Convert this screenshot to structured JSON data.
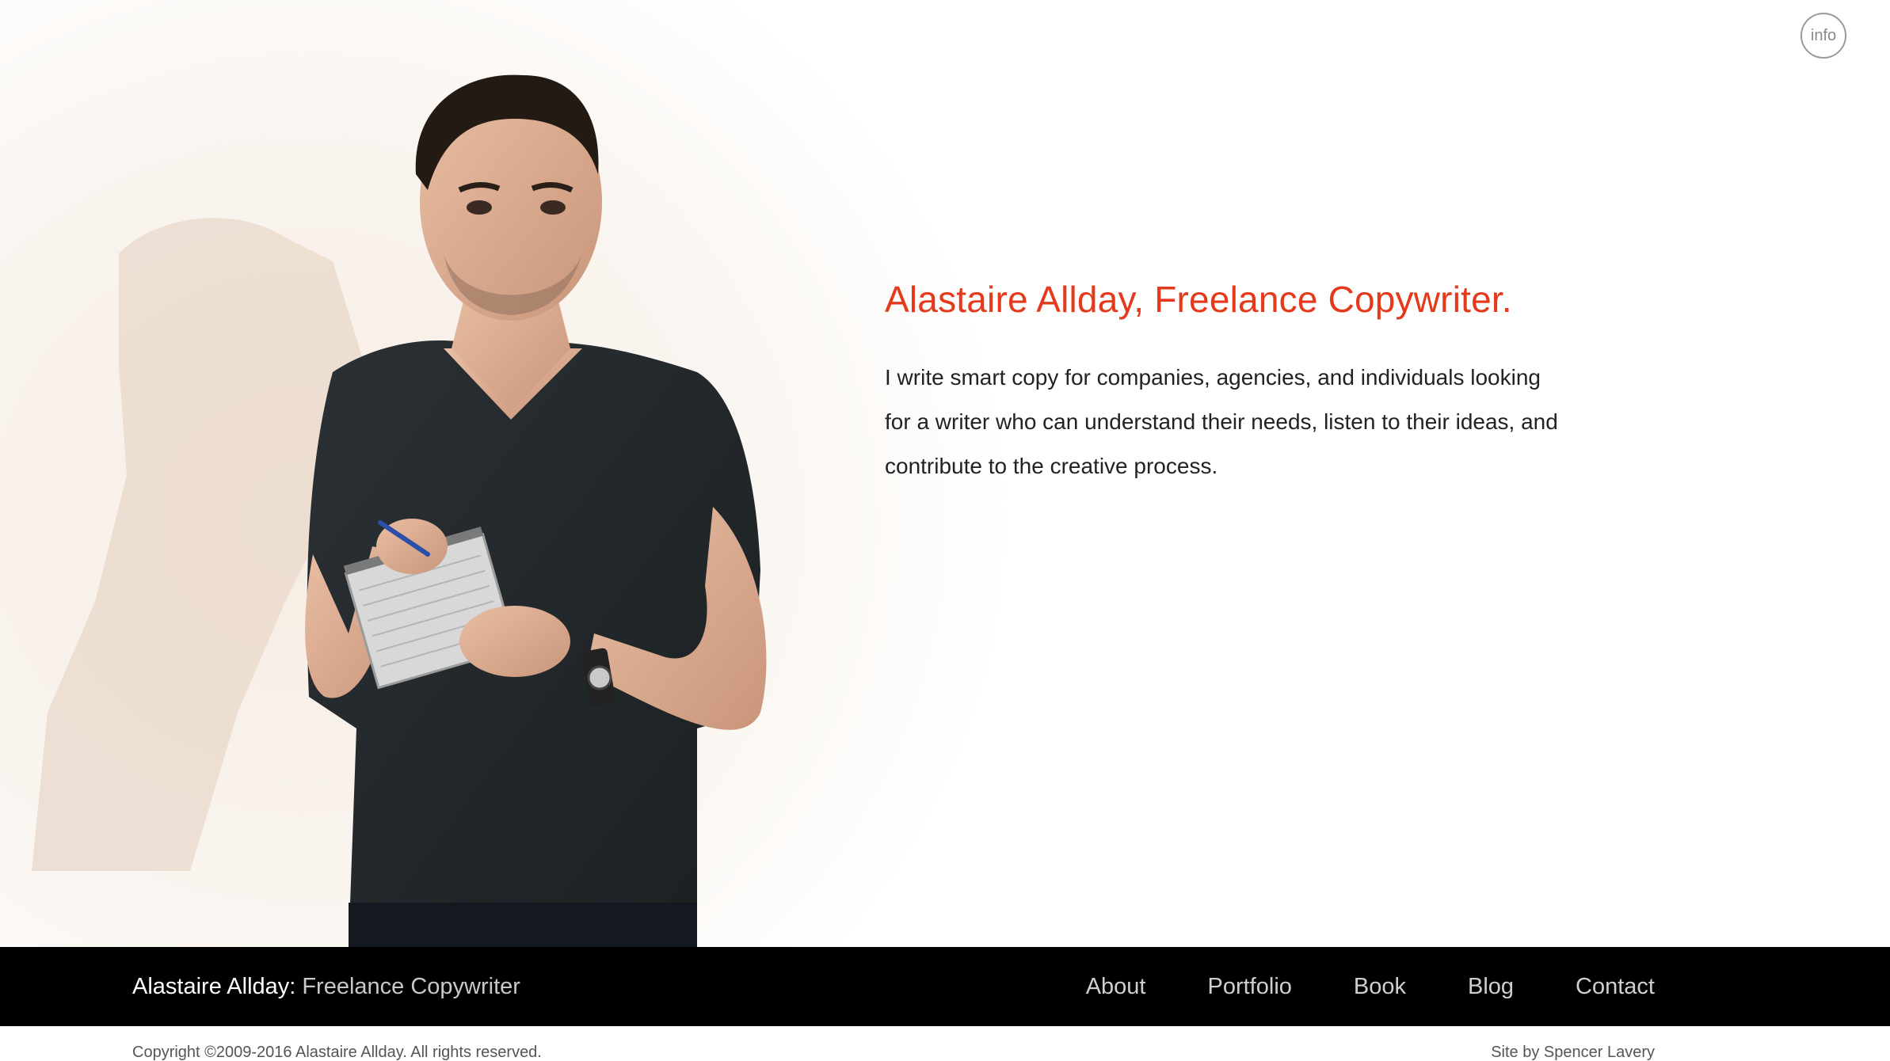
{
  "info_button": {
    "label": "info"
  },
  "intro": {
    "title": "Alastaire Allday, Freelance Copywriter.",
    "paragraph": "I write smart copy for companies, agencies, and individuals looking for a writer who can understand their needs, listen to their ideas, and contribute to the creative process."
  },
  "footer": {
    "brand_name": "Alastaire Allday:",
    "brand_role": "Freelance Copywriter",
    "nav": [
      {
        "label": "About"
      },
      {
        "label": "Portfolio"
      },
      {
        "label": "Book"
      },
      {
        "label": "Blog"
      },
      {
        "label": "Contact"
      }
    ]
  },
  "bottom": {
    "copyright": "Copyright ©2009-2016 Alastaire Allday. All rights reserved.",
    "credit": "Site by Spencer Lavery"
  },
  "colors": {
    "accent": "#e5391c",
    "footer_bg": "#000000",
    "text": "#222222",
    "nav_text": "#cfcfcf"
  }
}
